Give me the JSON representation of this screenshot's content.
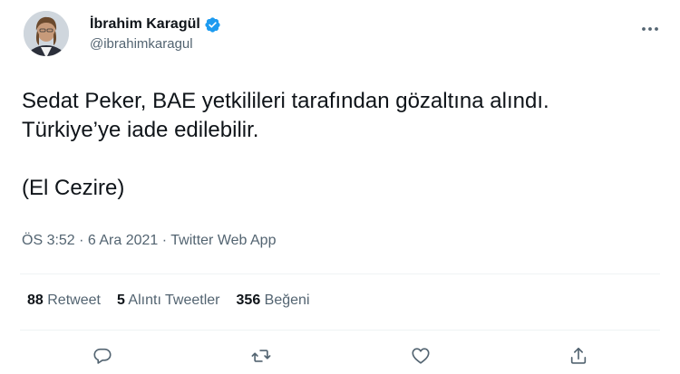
{
  "author": {
    "display_name": "İbrahim Karagül",
    "handle": "@ibrahimkaragul",
    "verified": true
  },
  "tweet": {
    "line1": "Sedat Peker, BAE yetkilileri tarafından gözaltına alındı.",
    "line2": "Türkiye’ye iade edilebilir.",
    "line3": "(El Cezire)"
  },
  "meta": {
    "time": "ÖS 3:52",
    "sep1": " · ",
    "date": "6 Ara 2021",
    "sep2": " · ",
    "app": "Twitter Web App"
  },
  "stats": {
    "retweets_count": "88",
    "retweets_label": "Retweet",
    "quotes_count": "5",
    "quotes_label": "Alıntı Tweetler",
    "likes_count": "356",
    "likes_label": "Beğeni"
  },
  "icons": {
    "verified": "verified-badge-icon",
    "more": "more-dots-icon",
    "reply": "reply-bubble-icon",
    "retweet": "retweet-arrows-icon",
    "like": "heart-icon",
    "share": "share-upload-icon"
  },
  "colors": {
    "verified": "#1d9bf0",
    "text_primary": "#0f1419",
    "text_secondary": "#536471",
    "divider": "#eff3f4"
  }
}
